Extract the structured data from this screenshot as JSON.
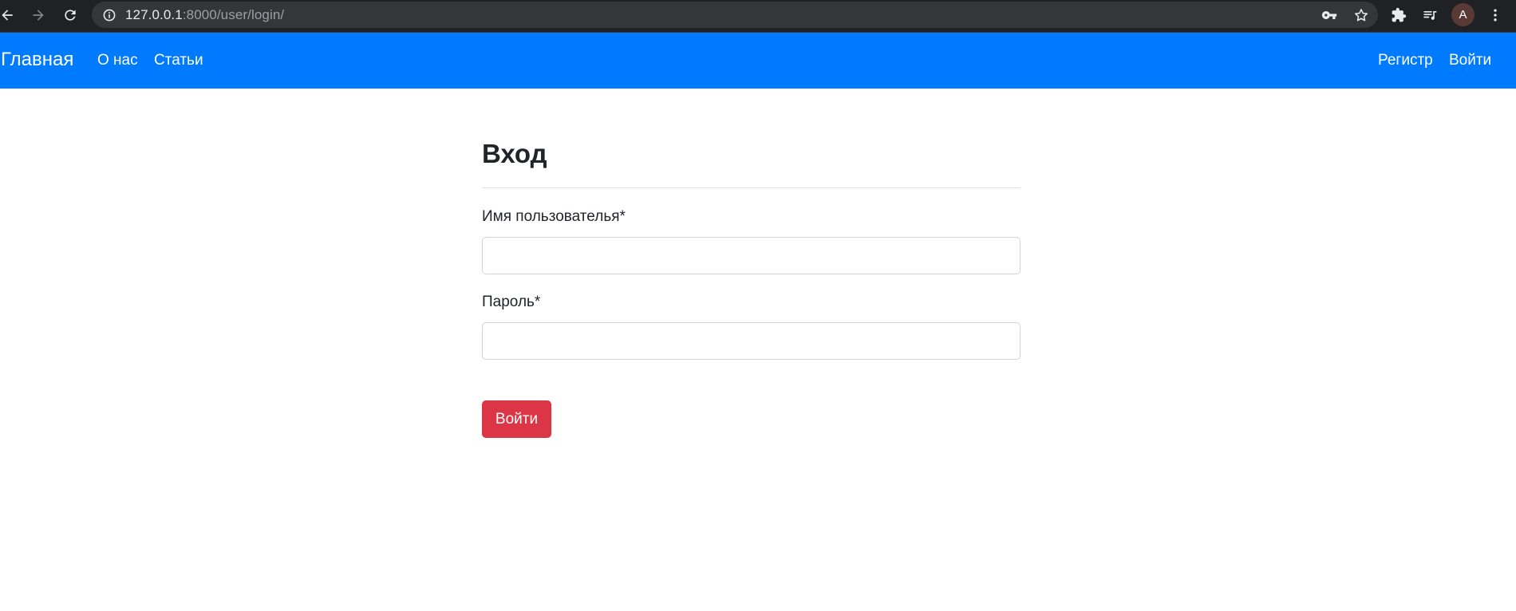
{
  "browser": {
    "url_host": "127.0.0.1",
    "url_rest": ":8000/user/login/",
    "profile_initial": "A",
    "icons": {
      "back": "back-arrow-icon",
      "forward": "forward-arrow-icon",
      "reload": "reload-icon",
      "site_info": "info-icon",
      "password_key": "key-icon",
      "bookmark": "star-icon",
      "extensions": "puzzle-icon",
      "media": "media-queue-icon",
      "menu": "kebab-menu-icon"
    }
  },
  "navbar": {
    "brand": "Главная",
    "left_links": [
      "О нас",
      "Статьи"
    ],
    "right_links": [
      "Регистр",
      "Войти"
    ],
    "background_color": "#007bff"
  },
  "form": {
    "title": "Вход",
    "username_label": "Имя пользователья*",
    "username_value": "",
    "password_label": "Пароль*",
    "password_value": "",
    "submit_label": "Войти",
    "submit_color": "#dc3545"
  }
}
